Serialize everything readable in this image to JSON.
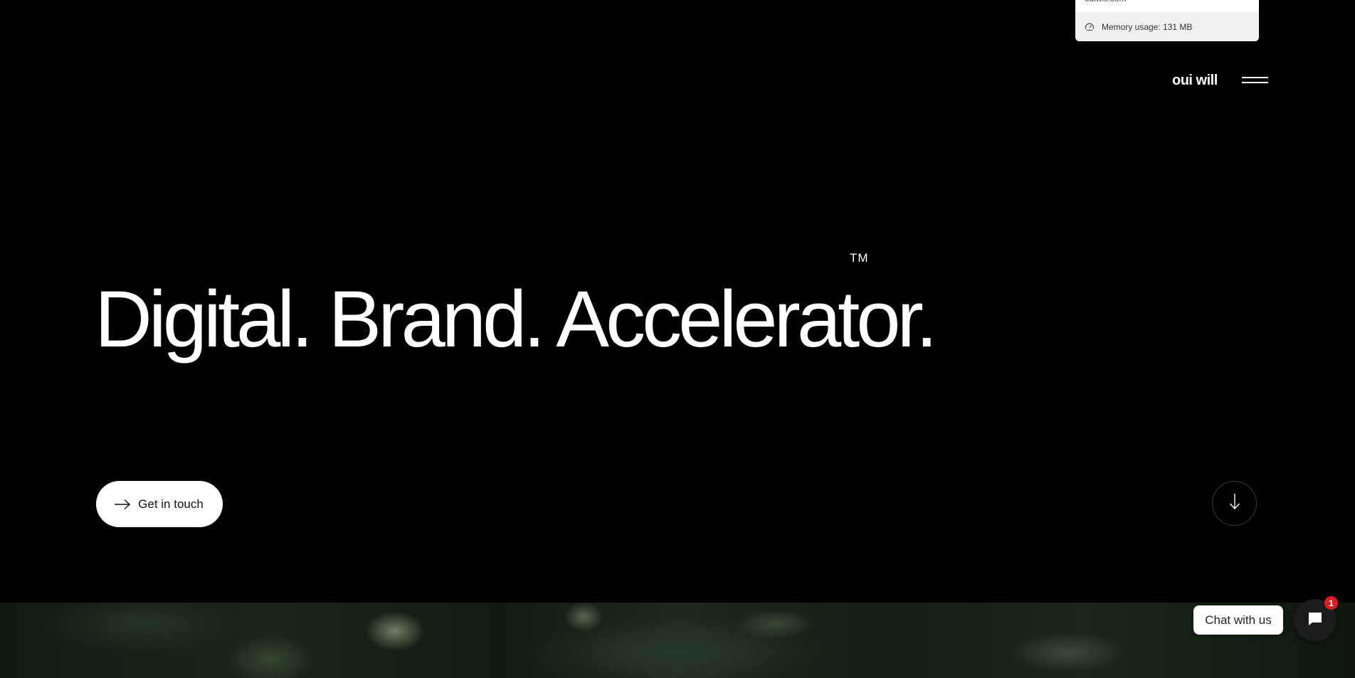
{
  "browser_popup": {
    "site": "ouiwill.com",
    "memory_label": "Memory usage: 131 MB"
  },
  "header": {
    "logo": "oui will"
  },
  "hero": {
    "title": "Digital. Brand. Accelerator.",
    "trademark": "TM",
    "cta_label": "Get in touch"
  },
  "chat": {
    "label": "Chat with us",
    "badge_count": "1"
  }
}
